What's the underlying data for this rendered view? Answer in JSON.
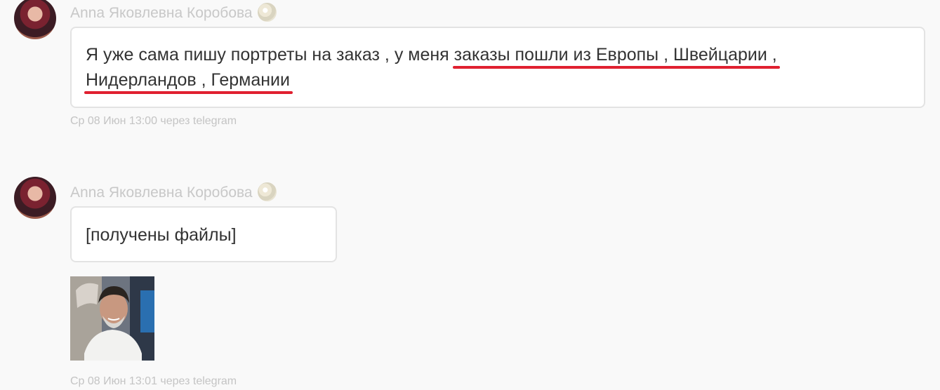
{
  "messages": [
    {
      "author": "Anna Яковлевна Коробова",
      "text_part1": "Я уже сама пишу портреты на заказ , у меня ",
      "text_highlight1": "заказы пошли из Европы , Швейцарии ,",
      "text_highlight2": "Нидерландов , Германии",
      "timestamp": "Ср 08 Июн 13:00 через telegram"
    },
    {
      "author": "Anna Яковлевна Коробова",
      "text": "[получены файлы]",
      "timestamp": "Ср 08 Июн 13:01 через telegram"
    }
  ],
  "colors": {
    "underline": "#e02030",
    "author": "#c8c8c8",
    "timestamp": "#c4c4c4"
  },
  "icons": [
    "avatar",
    "badge-icon",
    "attachment-image"
  ]
}
